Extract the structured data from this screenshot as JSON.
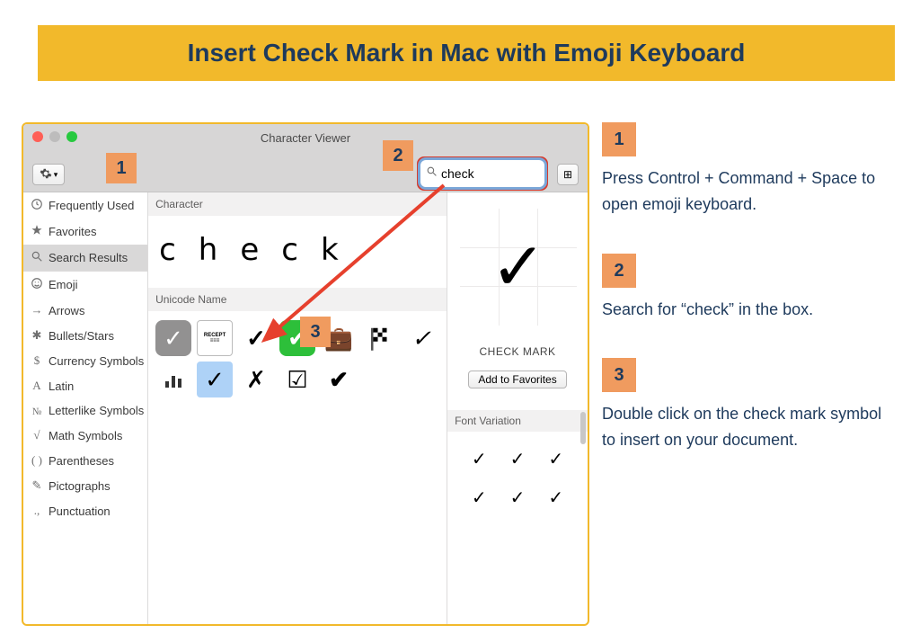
{
  "title": "Insert Check Mark in Mac with Emoji Keyboard",
  "window": {
    "title": "Character Viewer",
    "search": {
      "value": "check"
    },
    "sidebar": [
      {
        "label": "Frequently Used",
        "icon": "clock"
      },
      {
        "label": "Favorites",
        "icon": "star"
      },
      {
        "label": "Search Results",
        "icon": "search",
        "selected": true
      },
      {
        "sep": true
      },
      {
        "label": "Emoji",
        "icon": "smile"
      },
      {
        "label": "Arrows",
        "icon": "arrow"
      },
      {
        "label": "Bullets/Stars",
        "icon": "asterisk"
      },
      {
        "label": "Currency Symbols",
        "icon": "dollar"
      },
      {
        "label": "Latin",
        "icon": "A"
      },
      {
        "label": "Letterlike Symbols",
        "icon": "No"
      },
      {
        "label": "Math Symbols",
        "icon": "sqrt"
      },
      {
        "label": "Parentheses",
        "icon": "paren"
      },
      {
        "label": "Pictographs",
        "icon": "pencil"
      },
      {
        "label": "Punctuation",
        "icon": "quote"
      }
    ],
    "sections": {
      "char_label": "Character",
      "char_breakdown": [
        "c",
        "h",
        "e",
        "c",
        "k"
      ],
      "unicode_label": "Unicode Name",
      "font_var_label": "Font Variation"
    },
    "results_row1": [
      "box-check",
      "receipt",
      "heavy-check",
      "green-check",
      "bag",
      "flag",
      "ital-check"
    ],
    "results_row2": [
      "bars",
      "sel-check",
      "x",
      "ballot",
      "bold-check"
    ],
    "preview": {
      "glyph": "✓",
      "name": "CHECK MARK",
      "add_fav": "Add to Favorites"
    }
  },
  "annotations": {
    "a1": "1",
    "a2": "2",
    "a3": "3"
  },
  "steps": [
    {
      "num": "1",
      "text": "Press Control + Command + Space to open emoji keyboard."
    },
    {
      "num": "2",
      "text": "Search for “check” in the box."
    },
    {
      "num": "3",
      "text": "Double click on the check mark symbol to insert on your document."
    }
  ]
}
